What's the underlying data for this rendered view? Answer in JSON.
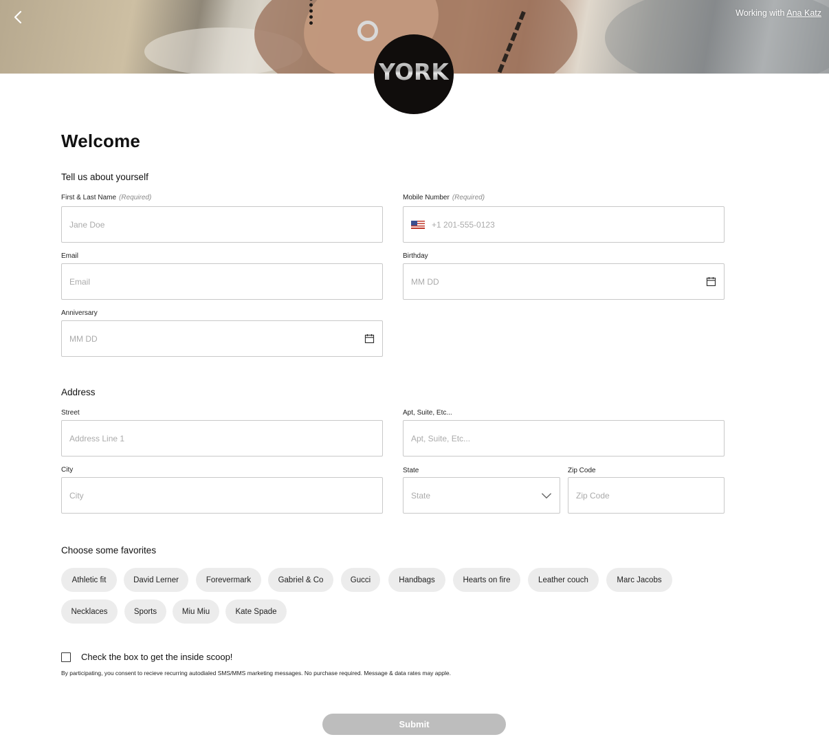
{
  "header": {
    "working_prefix": "Working with ",
    "associate_name": "Ana Katz",
    "logo_text": "YORK"
  },
  "page_title": "Welcome",
  "about": {
    "heading": "Tell us about yourself",
    "name_label": "First & Last Name",
    "name_required": "(Required)",
    "name_placeholder": "Jane Doe",
    "mobile_label": "Mobile Number",
    "mobile_required": "(Required)",
    "mobile_placeholder": "+1 201-555-0123",
    "email_label": "Email",
    "email_placeholder": "Email",
    "birthday_label": "Birthday",
    "birthday_placeholder": "MM DD",
    "anniversary_label": "Anniversary",
    "anniversary_placeholder": "MM DD"
  },
  "address": {
    "heading": "Address",
    "street_label": "Street",
    "street_placeholder": "Address Line 1",
    "apt_label": "Apt, Suite, Etc...",
    "apt_placeholder": "Apt, Suite, Etc...",
    "city_label": "City",
    "city_placeholder": "City",
    "state_label": "State",
    "state_placeholder": "State",
    "zip_label": "Zip Code",
    "zip_placeholder": "Zip Code"
  },
  "favorites": {
    "heading": "Choose some favorites",
    "chips": [
      "Athletic fit",
      "David Lerner",
      "Forevermark",
      "Gabriel & Co",
      "Gucci",
      "Handbags",
      "Hearts on fire",
      "Leather couch",
      "Marc Jacobs",
      "Necklaces",
      "Sports",
      "Miu Miu",
      "Kate Spade"
    ]
  },
  "consent": {
    "label": "Check the box to get the inside scoop!",
    "fineprint": "By participating, you consent to recieve recurring autodialed SMS/MMS marketing messages. No purchase required. Message & data rates may apple."
  },
  "submit_label": "Submit",
  "colors": {
    "submit_bg": "#bdbdbd",
    "chip_bg": "#ececec",
    "field_border": "#c8c8c8"
  }
}
